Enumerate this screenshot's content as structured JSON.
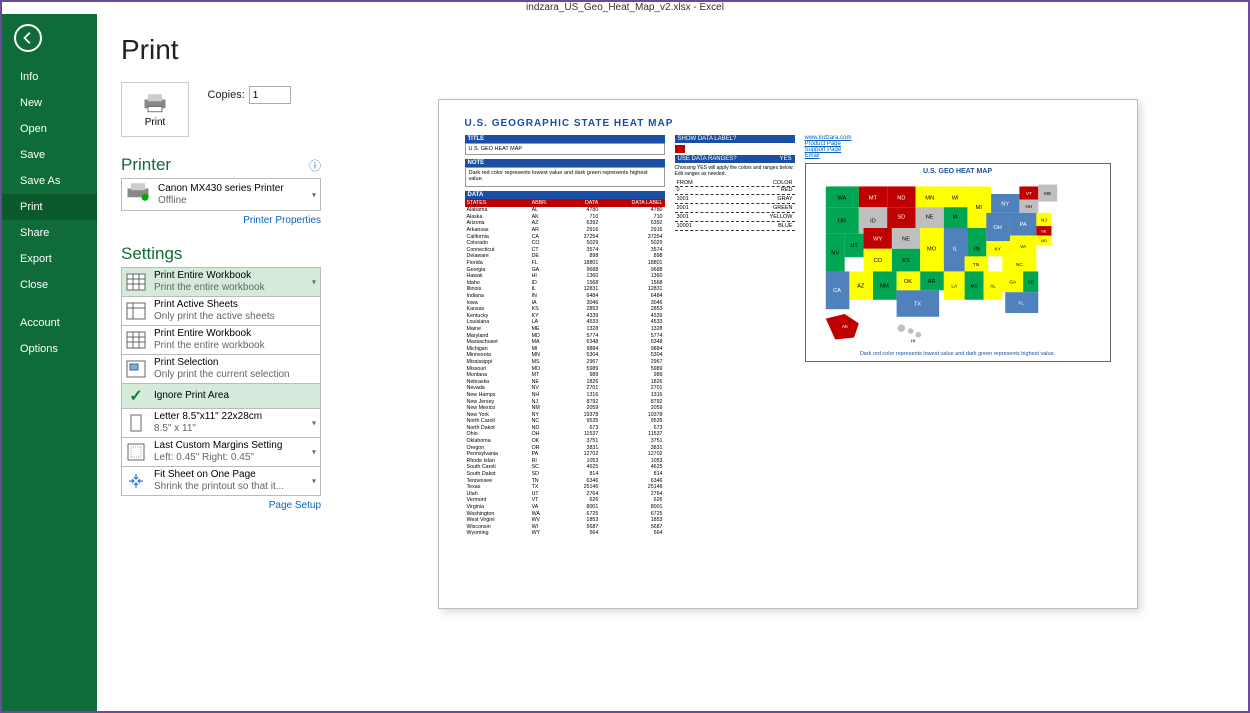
{
  "window_title": "indzara_US_Geo_Heat_Map_v2.xlsx - Excel",
  "nav": {
    "info": "Info",
    "new": "New",
    "open": "Open",
    "save": "Save",
    "save_as": "Save As",
    "print": "Print",
    "share": "Share",
    "export": "Export",
    "close": "Close",
    "account": "Account",
    "options": "Options"
  },
  "page_heading": "Print",
  "print_button_label": "Print",
  "copies_label": "Copies:",
  "copies_value": "1",
  "printer_heading": "Printer",
  "printer_name": "Canon MX430 series Printer",
  "printer_status": "Offline",
  "printer_properties": "Printer Properties",
  "settings_heading": "Settings",
  "settings": {
    "s0": {
      "title": "Print Entire Workbook",
      "sub": "Print the entire workbook"
    },
    "s1": {
      "title": "Print Active Sheets",
      "sub": "Only print the active sheets"
    },
    "s2": {
      "title": "Print Entire Workbook",
      "sub": "Print the entire workbook"
    },
    "s3": {
      "title": "Print Selection",
      "sub": "Only print the current selection"
    },
    "s4": {
      "title": "Ignore Print Area"
    },
    "s5": {
      "title": "Letter 8.5\"x11\" 22x28cm",
      "sub": "8.5\" x 11\""
    },
    "s6": {
      "title": "Last Custom Margins Setting",
      "sub": "Left: 0.45\"   Right: 0.45\""
    },
    "s7": {
      "title": "Fit Sheet on One Page",
      "sub": "Shrink the printout so that it..."
    }
  },
  "page_setup": "Page Setup",
  "preview": {
    "title": "U.S. GEOGRAPHIC STATE HEAT MAP",
    "title_label": "TITLE",
    "title_value": "U.S. GEO HEAT MAP",
    "note_label": "NOTE",
    "note_value": "Dark red color represents lowest value and dark green represents highest value.",
    "data_label": "DATA",
    "show_data_label": "SHOW DATA LABEL?",
    "use_data_ranges": "USE DATA RANGES?",
    "use_data_ranges_val": "YES",
    "ranges_note": "Choosing YES will apply the colors and ranges below. Edit ranges as needed.",
    "from_label": "FROM",
    "color_label": "COLOR",
    "ranges": [
      {
        "from": "0",
        "color": "RED"
      },
      {
        "from": "1001",
        "color": "GRAY"
      },
      {
        "from": "2001",
        "color": "GREEN"
      },
      {
        "from": "3001",
        "color": "YELLOW"
      },
      {
        "from": "10001",
        "color": "BLUE"
      }
    ],
    "links": {
      "site": "www.indzara.com",
      "product": "Product Page",
      "support": "Support Page",
      "email": "Email"
    },
    "map_title": "U.S. GEO HEAT MAP",
    "map_note": "Dark red color represents lowest value and dark green represents highest value.",
    "columns": {
      "states": "STATES",
      "abbr": "ABBR.",
      "data": "DATA",
      "label": "DATA LABEL"
    },
    "rows": [
      {
        "state": "Alabama",
        "abbr": "AL",
        "data": "4780",
        "label": "4780"
      },
      {
        "state": "Alaska",
        "abbr": "AK",
        "data": "710",
        "label": "710"
      },
      {
        "state": "Arizona",
        "abbr": "AZ",
        "data": "6392",
        "label": "6392"
      },
      {
        "state": "Arkansas",
        "abbr": "AR",
        "data": "2916",
        "label": "2916"
      },
      {
        "state": "California",
        "abbr": "CA",
        "data": "37254",
        "label": "37254"
      },
      {
        "state": "Colorado",
        "abbr": "CO",
        "data": "5029",
        "label": "5029"
      },
      {
        "state": "Connecticut",
        "abbr": "CT",
        "data": "3574",
        "label": "3574"
      },
      {
        "state": "Delaware",
        "abbr": "DE",
        "data": "898",
        "label": "898"
      },
      {
        "state": "Florida",
        "abbr": "FL",
        "data": "18801",
        "label": "18801"
      },
      {
        "state": "Georgia",
        "abbr": "GA",
        "data": "9688",
        "label": "9688"
      },
      {
        "state": "Hawaii",
        "abbr": "HI",
        "data": "1360",
        "label": "1360"
      },
      {
        "state": "Idaho",
        "abbr": "ID",
        "data": "1568",
        "label": "1568"
      },
      {
        "state": "Illinois",
        "abbr": "IL",
        "data": "12831",
        "label": "12831"
      },
      {
        "state": "Indiana",
        "abbr": "IN",
        "data": "6484",
        "label": "6484"
      },
      {
        "state": "Iowa",
        "abbr": "IA",
        "data": "3046",
        "label": "3046"
      },
      {
        "state": "Kansas",
        "abbr": "KS",
        "data": "2853",
        "label": "2853"
      },
      {
        "state": "Kentucky",
        "abbr": "KY",
        "data": "4339",
        "label": "4339"
      },
      {
        "state": "Louisiana",
        "abbr": "LA",
        "data": "4533",
        "label": "4533"
      },
      {
        "state": "Maine",
        "abbr": "ME",
        "data": "1328",
        "label": "1328"
      },
      {
        "state": "Maryland",
        "abbr": "MD",
        "data": "5774",
        "label": "5774"
      },
      {
        "state": "Massachuset",
        "abbr": "MA",
        "data": "6348",
        "label": "6348"
      },
      {
        "state": "Michigan",
        "abbr": "MI",
        "data": "9884",
        "label": "9884"
      },
      {
        "state": "Minnesota",
        "abbr": "MN",
        "data": "5304",
        "label": "5304"
      },
      {
        "state": "Mississippi",
        "abbr": "MS",
        "data": "2967",
        "label": "2967"
      },
      {
        "state": "Missouri",
        "abbr": "MO",
        "data": "5989",
        "label": "5989"
      },
      {
        "state": "Montana",
        "abbr": "MT",
        "data": "989",
        "label": "989"
      },
      {
        "state": "Nebraska",
        "abbr": "NE",
        "data": "1826",
        "label": "1826"
      },
      {
        "state": "Nevada",
        "abbr": "NV",
        "data": "2701",
        "label": "2701"
      },
      {
        "state": "New Hamps",
        "abbr": "NH",
        "data": "1316",
        "label": "1316"
      },
      {
        "state": "New Jersey",
        "abbr": "NJ",
        "data": "8792",
        "label": "8792"
      },
      {
        "state": "New Mexico",
        "abbr": "NM",
        "data": "2059",
        "label": "2059"
      },
      {
        "state": "New York",
        "abbr": "NY",
        "data": "19378",
        "label": "19378"
      },
      {
        "state": "North Caroli",
        "abbr": "NC",
        "data": "9535",
        "label": "9535"
      },
      {
        "state": "North Dakot",
        "abbr": "ND",
        "data": "673",
        "label": "673"
      },
      {
        "state": "Ohio",
        "abbr": "OH",
        "data": "11537",
        "label": "11537"
      },
      {
        "state": "Oklahoma",
        "abbr": "OK",
        "data": "3751",
        "label": "3751"
      },
      {
        "state": "Oregon",
        "abbr": "OR",
        "data": "3831",
        "label": "3831"
      },
      {
        "state": "Pennsylvania",
        "abbr": "PA",
        "data": "12702",
        "label": "12702"
      },
      {
        "state": "Rhode Islan",
        "abbr": "RI",
        "data": "1053",
        "label": "1053"
      },
      {
        "state": "South Caroli",
        "abbr": "SC",
        "data": "4625",
        "label": "4625"
      },
      {
        "state": "South Dakot",
        "abbr": "SD",
        "data": "814",
        "label": "814"
      },
      {
        "state": "Tennessee",
        "abbr": "TN",
        "data": "6346",
        "label": "6346"
      },
      {
        "state": "Texas",
        "abbr": "TX",
        "data": "25146",
        "label": "25146"
      },
      {
        "state": "Utah",
        "abbr": "UT",
        "data": "2764",
        "label": "2764"
      },
      {
        "state": "Vermont",
        "abbr": "VT",
        "data": "626",
        "label": "626"
      },
      {
        "state": "Virginia",
        "abbr": "VA",
        "data": "8001",
        "label": "8001"
      },
      {
        "state": "Washington",
        "abbr": "WA",
        "data": "6725",
        "label": "6725"
      },
      {
        "state": "West Virgini",
        "abbr": "WV",
        "data": "1853",
        "label": "1853"
      },
      {
        "state": "Wisconsin",
        "abbr": "WI",
        "data": "5687",
        "label": "5687"
      },
      {
        "state": "Wyoming",
        "abbr": "WY",
        "data": "564",
        "label": "564"
      }
    ]
  },
  "chart_data": {
    "type": "heatmap",
    "title": "U.S. GEO HEAT MAP",
    "categories": [
      "AL",
      "AK",
      "AZ",
      "AR",
      "CA",
      "CO",
      "CT",
      "DE",
      "FL",
      "GA",
      "HI",
      "ID",
      "IL",
      "IN",
      "IA",
      "KS",
      "KY",
      "LA",
      "ME",
      "MD",
      "MA",
      "MI",
      "MN",
      "MS",
      "MO",
      "MT",
      "NE",
      "NV",
      "NH",
      "NJ",
      "NM",
      "NY",
      "NC",
      "ND",
      "OH",
      "OK",
      "OR",
      "PA",
      "RI",
      "SC",
      "SD",
      "TN",
      "TX",
      "UT",
      "VT",
      "VA",
      "WA",
      "WV",
      "WI",
      "WY"
    ],
    "values": [
      4780,
      710,
      6392,
      2916,
      37254,
      5029,
      3574,
      898,
      18801,
      9688,
      1360,
      1568,
      12831,
      6484,
      3046,
      2853,
      4339,
      4533,
      1328,
      5774,
      6348,
      9884,
      5304,
      2967,
      5989,
      989,
      1826,
      2701,
      1316,
      8792,
      2059,
      19378,
      9535,
      673,
      11537,
      3751,
      3831,
      12702,
      1053,
      4625,
      814,
      6346,
      25146,
      2764,
      626,
      8001,
      6725,
      1853,
      5687,
      564
    ],
    "color_ranges": [
      {
        "from": 0,
        "color": "RED",
        "hex": "#c00000"
      },
      {
        "from": 1001,
        "color": "GRAY",
        "hex": "#bfbfbf"
      },
      {
        "from": 2001,
        "color": "GREEN",
        "hex": "#00a651"
      },
      {
        "from": 3001,
        "color": "YELLOW",
        "hex": "#ffff00"
      },
      {
        "from": 10001,
        "color": "BLUE",
        "hex": "#4f81bd"
      }
    ]
  }
}
